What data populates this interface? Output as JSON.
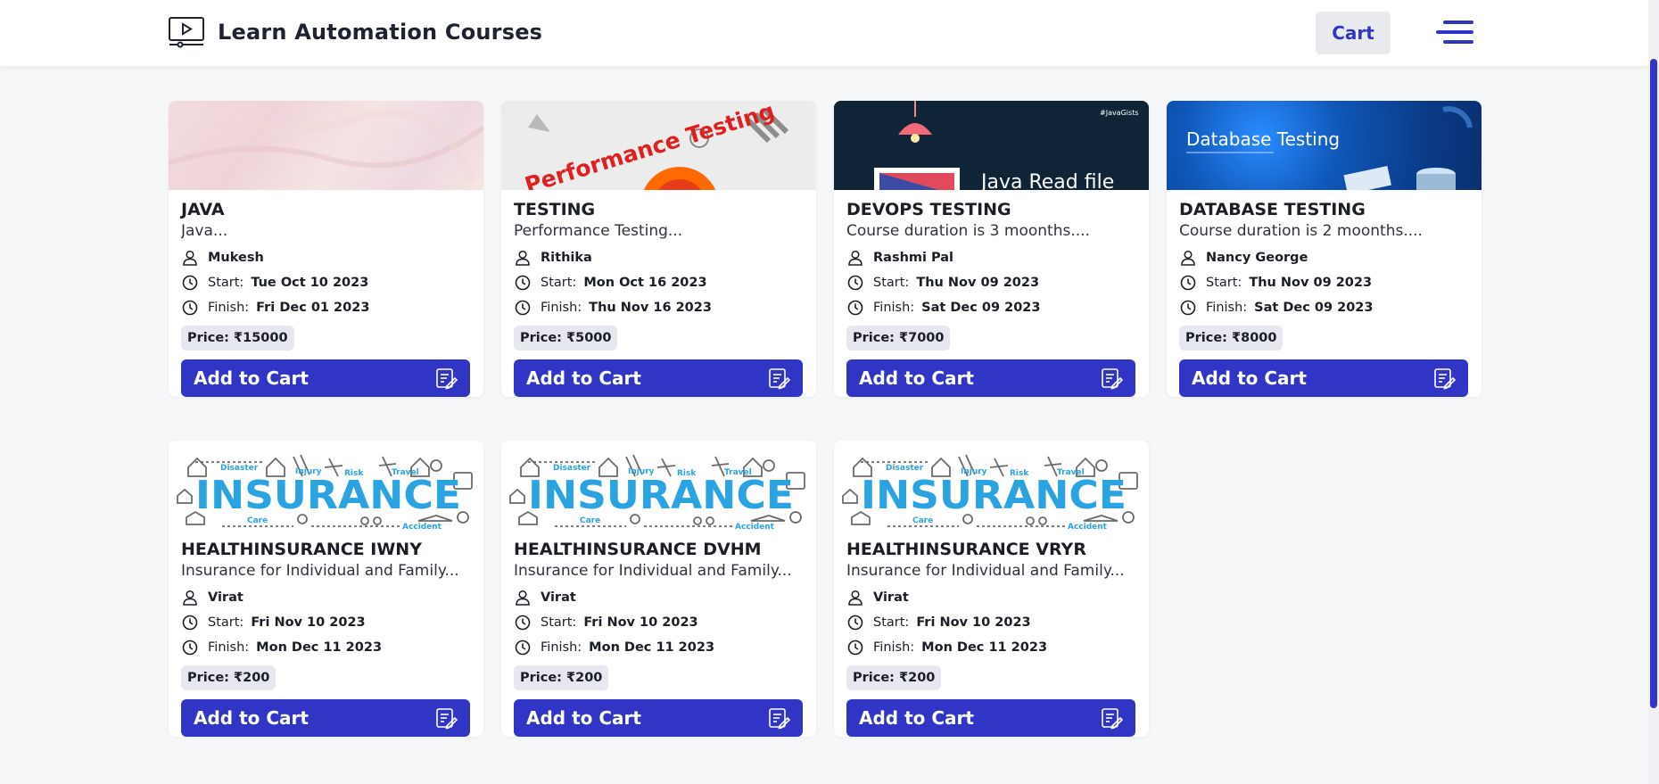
{
  "header": {
    "app_title": "Learn Automation Courses",
    "cart_label": "Cart",
    "brand_icon": "video-play-icon",
    "menu_icon": "hamburger-menu-icon"
  },
  "colors": {
    "accent": "#3135c6",
    "background": "#f6f7f9",
    "price_badge": "#e6e7ef"
  },
  "labels": {
    "start": "Start:",
    "finish": "Finish:",
    "add_to_cart": "Add to Cart"
  },
  "courses": [
    {
      "title": "JAVA",
      "description": "Java...",
      "instructor": "Mukesh",
      "start": "Tue Oct 10 2023",
      "finish": "Fri Dec 01 2023",
      "price": "Price: ₹15000"
    },
    {
      "title": "TESTING",
      "description": "Performance Testing...",
      "instructor": "Rithika",
      "start": "Mon Oct 16 2023",
      "finish": "Thu Nov 16 2023",
      "price": "Price: ₹5000",
      "thumb_text": "Performance Testing"
    },
    {
      "title": "DEVOPS TESTING",
      "description": "Course duration is 3 moonths....",
      "instructor": "Rashmi Pal",
      "start": "Thu Nov 09 2023",
      "finish": "Sat Dec 09 2023",
      "price": "Price: ₹7000",
      "thumb_text": "Java Read file",
      "thumb_tag": "#JavaGists"
    },
    {
      "title": "DATABASE TESTING",
      "description": "Course duration is 2 moonths....",
      "instructor": "Nancy George",
      "start": "Thu Nov 09 2023",
      "finish": "Sat Dec 09 2023",
      "price": "Price: ₹8000",
      "thumb_text": "Database Testing"
    },
    {
      "title": "HEALTHINSURANCE IWNY",
      "description": "Insurance for Individual and Family...",
      "instructor": "Virat",
      "start": "Fri Nov 10 2023",
      "finish": "Mon Dec 11 2023",
      "price": "Price: ₹200",
      "thumb_text": "INSURANCE"
    },
    {
      "title": "HEALTHINSURANCE DVHM",
      "description": "Insurance for Individual and Family...",
      "instructor": "Virat",
      "start": "Fri Nov 10 2023",
      "finish": "Mon Dec 11 2023",
      "price": "Price: ₹200",
      "thumb_text": "INSURANCE"
    },
    {
      "title": "HEALTHINSURANCE VRYR",
      "description": "Insurance for Individual and Family...",
      "instructor": "Virat",
      "start": "Fri Nov 10 2023",
      "finish": "Mon Dec 11 2023",
      "price": "Price: ₹200",
      "thumb_text": "INSURANCE"
    }
  ],
  "insurance_words": [
    "Disaster",
    "Injury",
    "Risk",
    "Travel",
    "Care",
    "Accident"
  ]
}
